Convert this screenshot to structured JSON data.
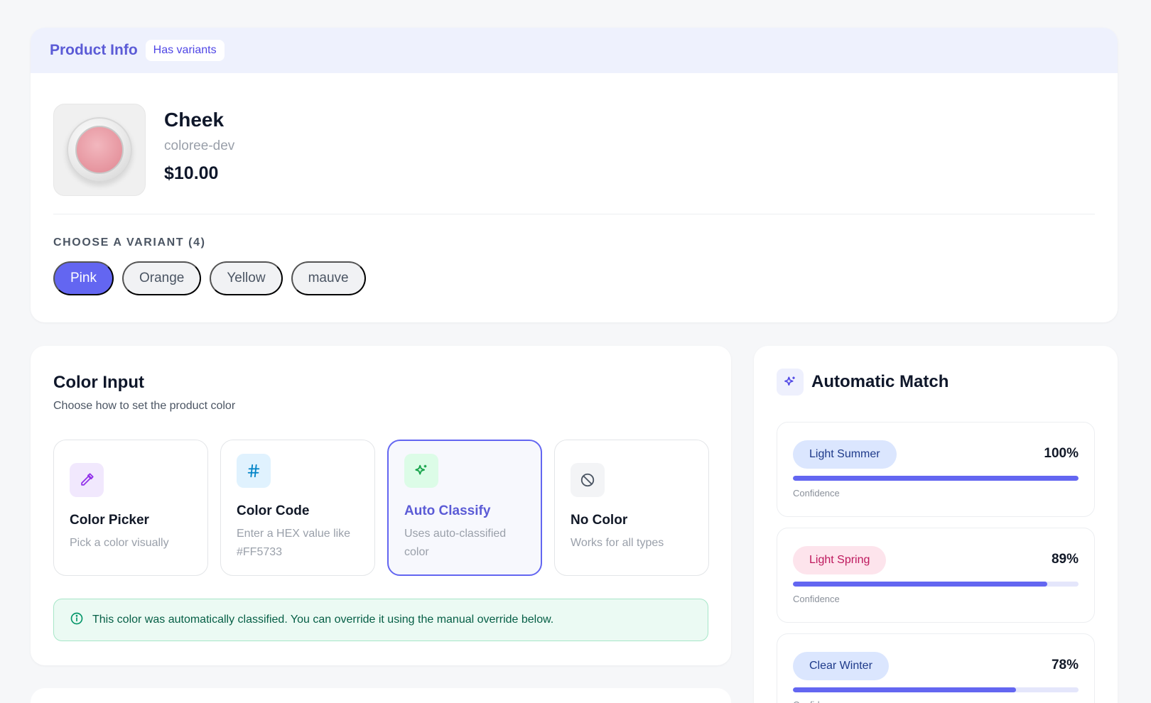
{
  "product_header": {
    "title": "Product Info",
    "badge": "Has variants"
  },
  "product": {
    "name": "Cheek",
    "vendor": "coloree-dev",
    "price": "$10.00",
    "image_alt": "blush compact"
  },
  "variants": {
    "label": "CHOOSE A VARIANT (4)",
    "items": [
      {
        "label": "Pink",
        "selected": true
      },
      {
        "label": "Orange",
        "selected": false
      },
      {
        "label": "Yellow",
        "selected": false
      },
      {
        "label": "mauve",
        "selected": false
      }
    ]
  },
  "color_input": {
    "title": "Color Input",
    "subtitle": "Choose how to set the product color",
    "options": [
      {
        "title": "Color Picker",
        "desc": "Pick a color visually",
        "icon": "eyedropper-icon",
        "icon_bg": "#f1e8fd",
        "icon_color": "#9333ea",
        "selected": false
      },
      {
        "title": "Color Code",
        "desc": "Enter a HEX value like #FF5733",
        "icon": "hash-icon",
        "icon_bg": "#e0f2fe",
        "icon_color": "#0284c7",
        "selected": false
      },
      {
        "title": "Auto Classify",
        "desc": "Uses auto-classified color",
        "icon": "sparkle-icon",
        "icon_bg": "#dcfce7",
        "icon_color": "#16a34a",
        "selected": true
      },
      {
        "title": "No Color",
        "desc": "Works for all types",
        "icon": "ban-icon",
        "icon_bg": "#f3f4f6",
        "icon_color": "#4b5563",
        "selected": false
      }
    ],
    "info": "This color was automatically classified. You can override it using the manual override below."
  },
  "automatic_match": {
    "title": "Automatic Match",
    "confidence_label": "Confidence",
    "matches": [
      {
        "season": "Light Summer",
        "percent_text": "100%",
        "confidence": 1.0,
        "pill_bg": "#dbe6fe",
        "pill_color": "#1e3a8a"
      },
      {
        "season": "Light Spring",
        "percent_text": "89%",
        "confidence": 0.89,
        "pill_bg": "#fde4ec",
        "pill_color": "#be185d"
      },
      {
        "season": "Clear Winter",
        "percent_text": "78%",
        "confidence": 0.78,
        "pill_bg": "#dbe6fe",
        "pill_color": "#1e3a8a"
      }
    ]
  },
  "colors": {
    "accent": "#6366f1",
    "page_bg": "#f6f7f9"
  }
}
